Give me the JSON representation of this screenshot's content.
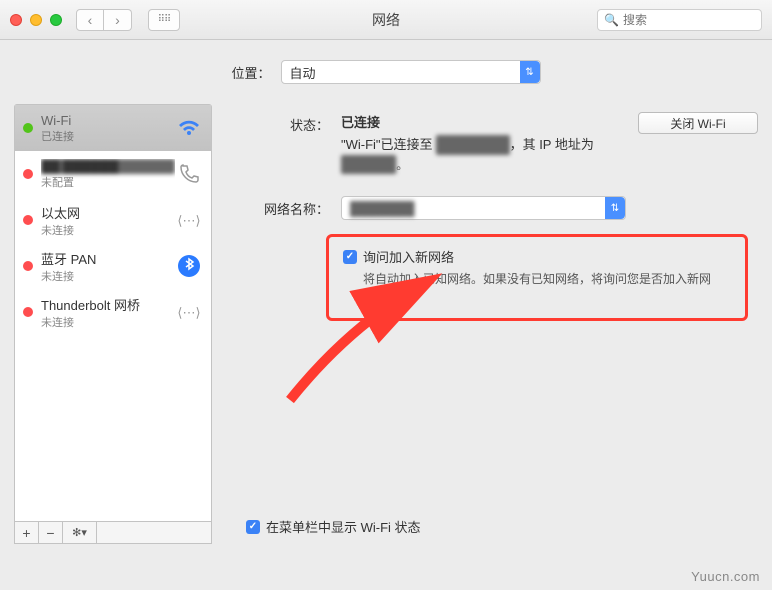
{
  "window": {
    "title": "网络"
  },
  "search": {
    "placeholder": "搜索"
  },
  "location": {
    "label": "位置：",
    "value": "自动"
  },
  "sidebar": {
    "items": [
      {
        "name": "Wi-Fi",
        "sub": "已连接",
        "status": "g",
        "icon": "wifi"
      },
      {
        "name": "██ ██████",
        "sub": "未配置",
        "status": "r",
        "icon": "phone",
        "blur": true
      },
      {
        "name": "以太网",
        "sub": "未连接",
        "status": "r",
        "icon": "eth"
      },
      {
        "name": "蓝牙 PAN",
        "sub": "未连接",
        "status": "r",
        "icon": "bt"
      },
      {
        "name": "Thunderbolt 网桥",
        "sub": "未连接",
        "status": "r",
        "icon": "eth"
      }
    ],
    "foot": {
      "add": "+",
      "remove": "−",
      "gear": "✻▾"
    }
  },
  "main": {
    "status_label": "状态：",
    "status_value": "已连接",
    "toggle_btn": "关闭 Wi-Fi",
    "status_desc_prefix": "\"Wi-Fi\"已连接至",
    "status_desc_net": "████████",
    "status_desc_suffix": "，其 IP 地址为",
    "status_desc_ip": "██████",
    "netname_label": "网络名称：",
    "netname_value": "███████",
    "ask_label": "询问加入新网络",
    "ask_desc": "将自动加入已知网络。如果没有已知网络，将询问您是否加入新网络。",
    "menubar_label": "在菜单栏中显示 Wi-Fi 状态"
  },
  "watermark": "Yuucn.com"
}
